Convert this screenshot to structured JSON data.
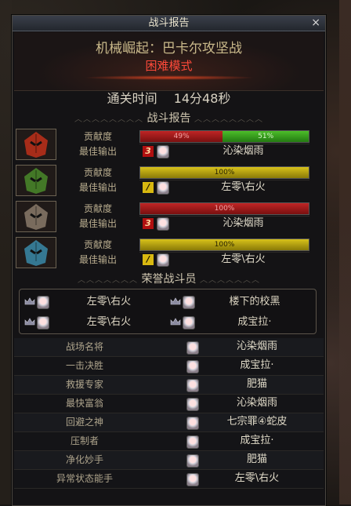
{
  "window": {
    "title": "战斗报告",
    "close_glyph": "×"
  },
  "header": {
    "dungeon": "机械崛起：巴卡尔攻坚战",
    "difficulty": "困难模式"
  },
  "clear": {
    "label": "通关时间",
    "time": "14分48秒"
  },
  "section_report": "战斗报告",
  "section_honor": "荣誉战斗员",
  "players": [
    {
      "contrib_label": "贡献度",
      "best_label": "最佳输出",
      "bar": [
        {
          "pct": 49,
          "text": "49%",
          "color": "red"
        },
        {
          "pct": 51,
          "text": "51%",
          "color": "green"
        }
      ],
      "badge": "3",
      "badge_color": "red",
      "best_name": "沁染烟雨",
      "avatar_color": "#c0301a"
    },
    {
      "contrib_label": "贡献度",
      "best_label": "最佳输出",
      "bar": [
        {
          "pct": 100,
          "text": "100%",
          "color": "yellow"
        }
      ],
      "badge": "/",
      "badge_color": "yellow",
      "best_name": "左零\\右火",
      "avatar_color": "#4a8a2a"
    },
    {
      "contrib_label": "贡献度",
      "best_label": "最佳输出",
      "bar": [
        {
          "pct": 100,
          "text": "100%",
          "color": "red"
        }
      ],
      "badge": "3",
      "badge_color": "red",
      "best_name": "沁染烟雨",
      "avatar_color": "#8a7a6a"
    },
    {
      "contrib_label": "贡献度",
      "best_label": "最佳输出",
      "bar": [
        {
          "pct": 100,
          "text": "100%",
          "color": "yellow"
        }
      ],
      "badge": "/",
      "badge_color": "yellow",
      "best_name": "左零\\右火",
      "avatar_color": "#3a8aa8"
    }
  ],
  "honor": [
    {
      "name": "左零\\右火"
    },
    {
      "name": "楼下的校黑"
    },
    {
      "name": "左零\\右火"
    },
    {
      "name": "成宝拉·"
    }
  ],
  "awards": [
    {
      "title": "战场名将",
      "name": "沁染烟雨"
    },
    {
      "title": "一击决胜",
      "name": "成宝拉·"
    },
    {
      "title": "救援专家",
      "name": "肥猫"
    },
    {
      "title": "最快富翁",
      "name": "沁染烟雨"
    },
    {
      "title": "回避之神",
      "name": "七宗罪④蛇皮"
    },
    {
      "title": "压制者",
      "name": "成宝拉·"
    },
    {
      "title": "净化妙手",
      "name": "肥猫"
    },
    {
      "title": "异常状态能手",
      "name": "左零\\右火"
    }
  ],
  "colors": {
    "red": "#c02525",
    "green": "#4cbd2a",
    "yellow": "#d8c21a",
    "difficulty": "#ff4a3a"
  }
}
